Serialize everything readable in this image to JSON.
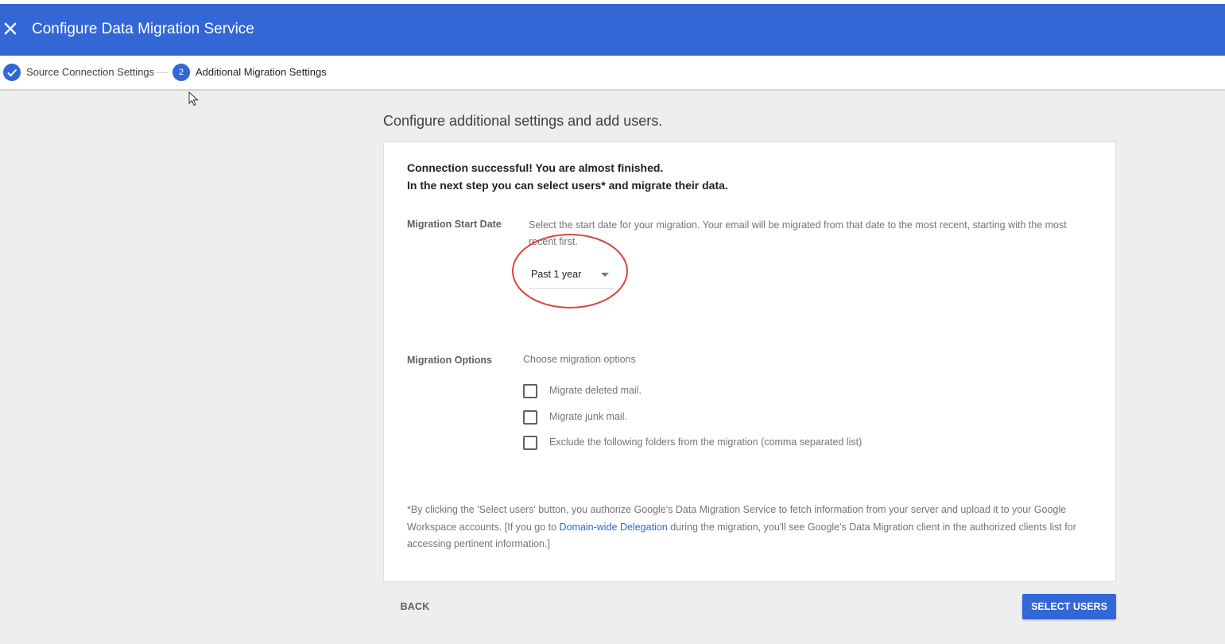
{
  "header": {
    "title": "Configure Data Migration Service",
    "close_icon": "close-icon",
    "background_color": "#3367d6"
  },
  "stepper": {
    "steps": [
      {
        "label": "Source Connection Settings",
        "state": "completed",
        "icon": "check-icon"
      },
      {
        "label": "Additional Migration Settings",
        "state": "active",
        "number": "2"
      }
    ]
  },
  "page": {
    "heading": "Configure additional settings and add users."
  },
  "card": {
    "success_line1": "Connection successful! You are almost finished.",
    "success_line2": "In the next step you can select users* and migrate their data.",
    "start_date": {
      "label": "Migration Start Date",
      "description": "Select the start date for your migration. Your email will be migrated from that date to the most recent, starting with the most recent first.",
      "selected": "Past 1 year"
    },
    "options": {
      "label": "Migration Options",
      "description": "Choose migration options",
      "checkboxes": [
        {
          "label": "Migrate deleted mail.",
          "checked": false
        },
        {
          "label": "Migrate junk mail.",
          "checked": false
        },
        {
          "label": "Exclude the following folders from the migration (comma separated list)",
          "checked": false
        }
      ]
    },
    "disclaimer": {
      "before_link": "*By clicking the 'Select users' button, you authorize Google's Data Migration Service to fetch information from your server and upload it to your Google Workspace accounts. [If you go to ",
      "link": "Domain-wide Delegation",
      "after_link": " during the migration, you'll see Google's Data Migration client in the authorized clients list for accessing pertinent information.]"
    }
  },
  "footer": {
    "back_label": "BACK",
    "select_users_label": "SELECT USERS"
  },
  "colors": {
    "accent": "#3367d6",
    "annotation": "#d9453f"
  }
}
